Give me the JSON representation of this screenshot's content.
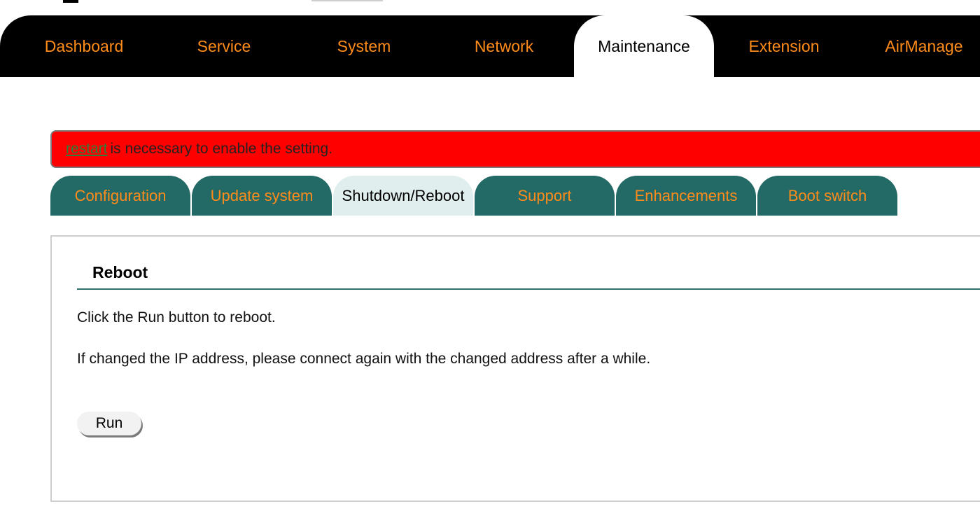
{
  "main_nav": {
    "tabs": [
      {
        "label": "Dashboard",
        "active": false
      },
      {
        "label": "Service",
        "active": false
      },
      {
        "label": "System",
        "active": false
      },
      {
        "label": "Network",
        "active": false
      },
      {
        "label": "Maintenance",
        "active": true
      },
      {
        "label": "Extension",
        "active": false
      },
      {
        "label": "AirManage",
        "active": false
      }
    ]
  },
  "alert": {
    "link_text": "restart",
    "message": "is necessary to enable the setting."
  },
  "sub_tabs": [
    {
      "label": "Configuration",
      "active": false
    },
    {
      "label": "Update system",
      "active": false
    },
    {
      "label": "Shutdown/Reboot",
      "active": true
    },
    {
      "label": "Support",
      "active": false
    },
    {
      "label": "Enhancements",
      "active": false
    },
    {
      "label": "Boot switch",
      "active": false
    }
  ],
  "reboot": {
    "title": "Reboot",
    "instruction": "Click the Run button to reboot.",
    "note": "If changed the IP address, please connect again with the changed address after a while.",
    "run_label": "Run"
  },
  "colors": {
    "nav_background": "#000000",
    "nav_text": "#ff8c1a",
    "alert_background": "#ff0000",
    "subtab_background": "#236966",
    "subtab_active_background": "#e1eeee",
    "section_rule": "#2f6f6c"
  }
}
